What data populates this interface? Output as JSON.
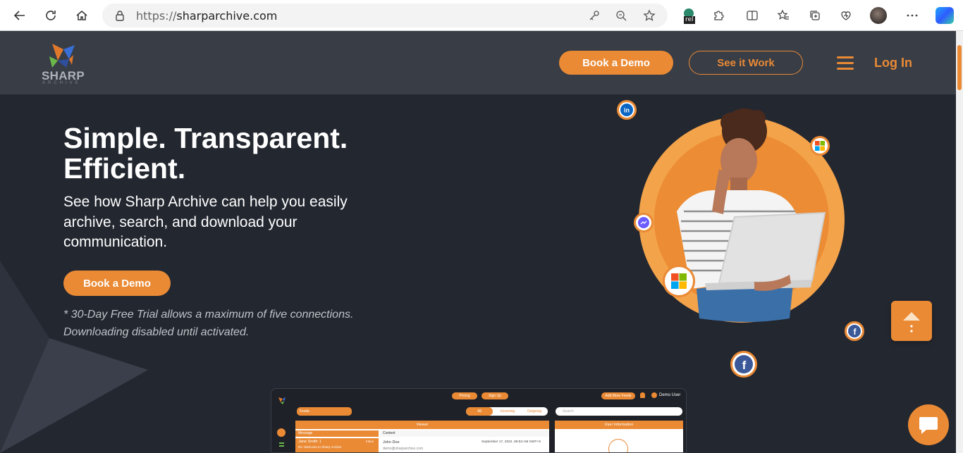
{
  "browser": {
    "url_protocol": "https://",
    "url_host": "sharparchive.com",
    "extension_badge": "rel"
  },
  "header": {
    "logo_text": "SHARP",
    "logo_subtext": "ARCHIVE",
    "book_demo_label": "Book a Demo",
    "see_it_work_label": "See it Work",
    "login_label": "Log In"
  },
  "hero": {
    "headline_line1": "Simple. Transparent.",
    "headline_line2": "Efficient.",
    "subheadline": "See how Sharp Archive can help you easily archive, search, and download your communication.",
    "cta_label": "Book a Demo",
    "disclaimer_line1": "* 30-Day Free Trial allows a maximum of five connections.",
    "disclaimer_line2": "Downloading disabled until activated."
  },
  "app_preview": {
    "pricing_label": "Pricing",
    "signup_label": "Sign Up",
    "add_feeds_label": "Add More Feeds",
    "user_label": "Demo User",
    "feeds_label": "Feeds",
    "filter_all": "All",
    "filter_incoming": "Incoming",
    "filter_outgoing": "Outgoing",
    "search_placeholder": "Search",
    "viewer_title": "Viewer",
    "user_info_title": "User Information",
    "col_message": "Message",
    "col_content": "Content",
    "row_name": "Jane Smith",
    "row_count": "1",
    "row_tag": "Inbox",
    "row_subject": "Re: Welcome to Sharp Archive",
    "content_name": "John Doe",
    "content_email": "demo@sharparchive.com",
    "content_date": "September 17, 2022 ,09:53 AM GMT+6"
  },
  "colors": {
    "accent": "#ea8a35",
    "header_bg": "#383d46",
    "page_bg": "#232730"
  }
}
